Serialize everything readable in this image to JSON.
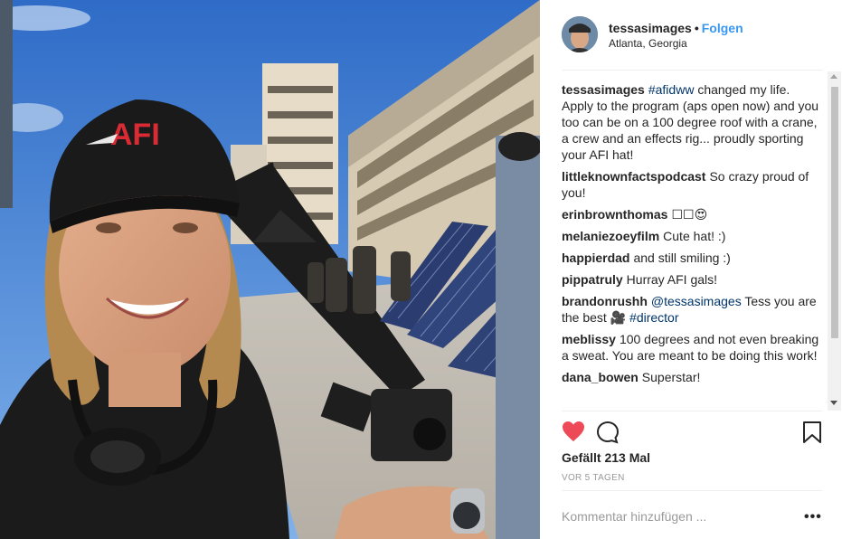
{
  "header": {
    "username": "tessasimages",
    "separator": "•",
    "follow_label": "Folgen",
    "location": "Atlanta, Georgia"
  },
  "photo": {
    "cap_logo": "AFI",
    "description_icon": "photo"
  },
  "comments": [
    {
      "user": "tessasimages",
      "tag": "#afidww",
      "text": " changed my life. Apply to the program (aps open now) and you too can be on a 100 degree roof with a crane, a crew and an effects rig... proudly sporting your AFI hat!"
    },
    {
      "user": "littleknownfactspodcast",
      "text": "So crazy proud of you!"
    },
    {
      "user": "erinbrownthomas",
      "text": "☐☐😍"
    },
    {
      "user": "melaniezoeyfilm",
      "text": "Cute hat! :)"
    },
    {
      "user": "happierdad",
      "text": "and still smiling :)"
    },
    {
      "user": "pippatruly",
      "text": "Hurray AFI gals!"
    },
    {
      "user": "brandonrushh",
      "mention": "@tessasimages",
      "text": " Tess you are the best 🎥 ",
      "tag2": "#director"
    },
    {
      "user": "meblissy",
      "text": "100 degrees and not even breaking a sweat. You are meant to be doing this work!"
    },
    {
      "user": "dana_bowen",
      "text": "Superstar!"
    }
  ],
  "actions": {
    "likes_text": "Gefällt 213 Mal",
    "timestamp": "VOR 5 TAGEN",
    "heart_color": "#ed4956",
    "icons": [
      "heart-icon",
      "comment-icon",
      "bookmark-icon"
    ]
  },
  "add_comment": {
    "placeholder": "Kommentar hinzufügen ...",
    "more_label": "•••"
  },
  "colors": {
    "link": "#003569",
    "follow": "#3897f0",
    "muted": "#999999"
  }
}
